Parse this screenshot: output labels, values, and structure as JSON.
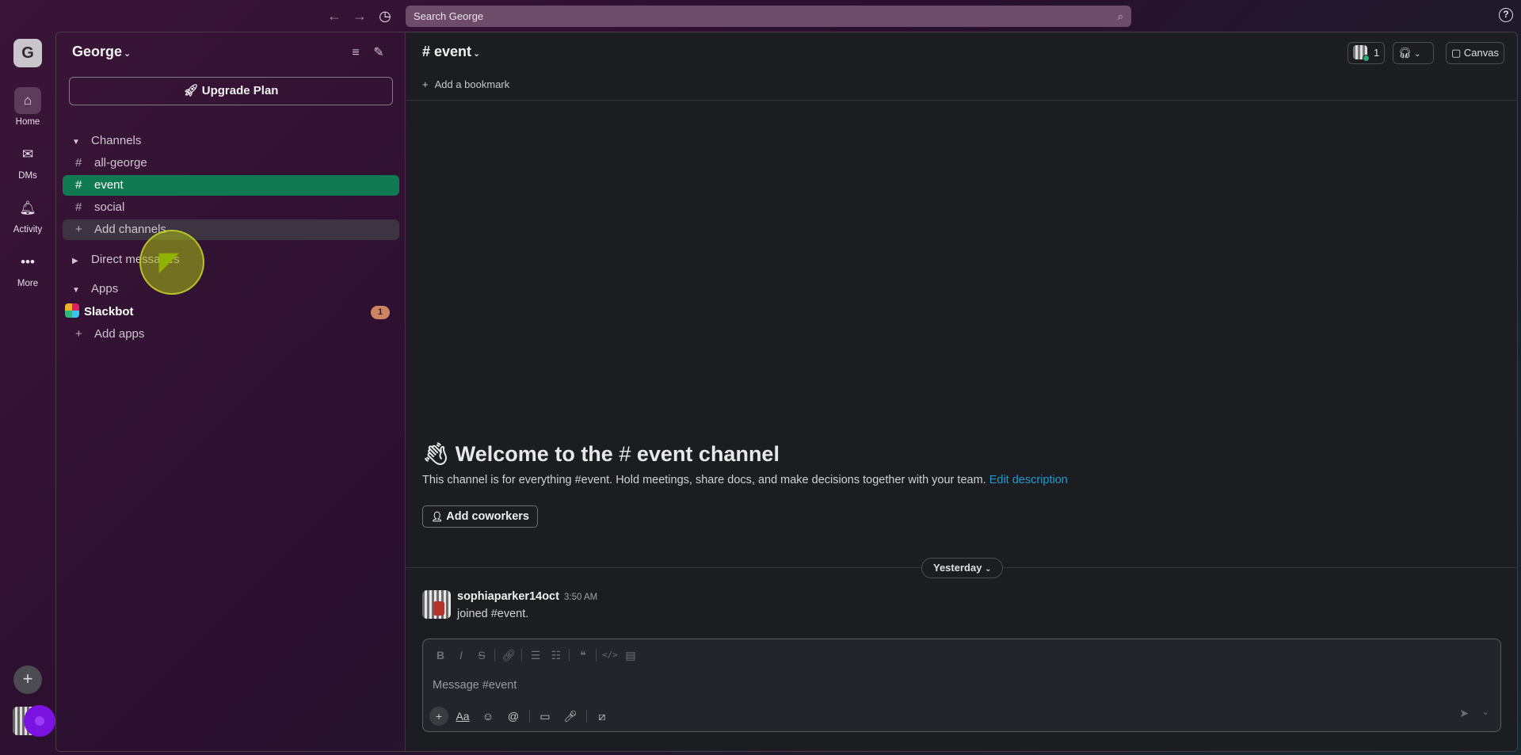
{
  "topbar": {
    "search_placeholder": "Search George",
    "help": "?"
  },
  "rail": {
    "workspace_initial": "G",
    "items": [
      {
        "label": "Home"
      },
      {
        "label": "DMs"
      },
      {
        "label": "Activity"
      },
      {
        "label": "More"
      }
    ]
  },
  "sidebar": {
    "workspace_name": "George",
    "upgrade_label": "Upgrade Plan",
    "channels_heading": "Channels",
    "channels": [
      {
        "name": "all-george"
      },
      {
        "name": "event"
      },
      {
        "name": "social"
      }
    ],
    "add_channels": "Add channels",
    "direct_messages_heading": "Direct messages",
    "apps_heading": "Apps",
    "apps": [
      {
        "name": "Slackbot",
        "badge": "1"
      }
    ],
    "add_apps": "Add apps"
  },
  "main": {
    "channel_title": "event",
    "add_bookmark": "Add a bookmark",
    "header": {
      "member_count": "1",
      "canvas_label": "Canvas"
    },
    "welcome": {
      "prefix": "Welcome to the",
      "channel": "event channel",
      "description": "This channel is for everything #event. Hold meetings, share docs, and make decisions together with your team.",
      "edit_link": "Edit description",
      "add_coworkers": "Add coworkers"
    },
    "day_divider": "Yesterday",
    "messages": [
      {
        "user": "sophiaparker14oct",
        "time": "3:50 AM",
        "text": "joined #event."
      }
    ],
    "composer": {
      "placeholder": "Message #event"
    }
  },
  "colors": {
    "active_channel": "#0f7a52",
    "link": "#1d9bd1",
    "badge": "#cc8461"
  }
}
